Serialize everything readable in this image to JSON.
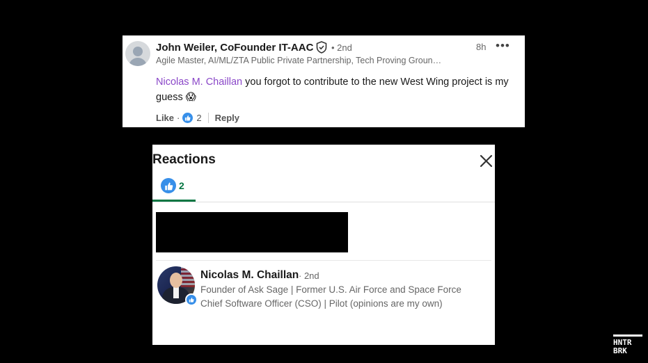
{
  "comment": {
    "author": "John Weiler, CoFounder IT-AAC",
    "degree": "• 2nd",
    "time": "8h",
    "more": "•••",
    "headline": "Agile Master, AI/ML/ZTA Public Private Partnership, Tech Proving Groun…",
    "mention": "Nicolas M. Chaillan",
    "text": " you forgot to contribute to the new West Wing project is my guess 😱",
    "like_label": "Like",
    "like_dot": "·",
    "like_count": "2",
    "reply_label": "Reply"
  },
  "reactions": {
    "title": "Reactions",
    "tab_count": "2",
    "person": {
      "name": "Nicolas M. Chaillan",
      "degree": "· 2nd",
      "headline": "Founder of Ask Sage | Former U.S. Air Force and Space Force Chief Software Officer (CSO) | Pilot (opinions are my own)"
    }
  },
  "watermark": {
    "line1": "HNTR",
    "line2": "BRK"
  },
  "colors": {
    "background": "#000000",
    "mention": "#8a47c8",
    "like_blue": "#378fe9",
    "tab_green": "#057642"
  },
  "icons": [
    "default-avatar-icon",
    "verified-shield-icon",
    "more-options-icon",
    "thumbs-up-icon",
    "close-icon"
  ]
}
